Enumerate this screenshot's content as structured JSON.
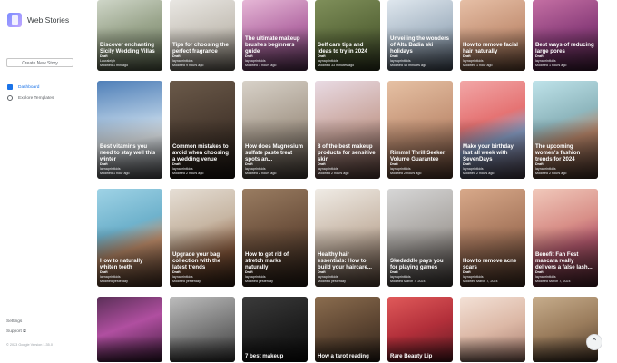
{
  "app": {
    "name": "Web Stories",
    "create_label": "Create New Story"
  },
  "nav": {
    "items": [
      {
        "label": "Dashboard",
        "active": true
      },
      {
        "label": "Explore Templates",
        "active": false
      }
    ],
    "settings_label": "Settings",
    "support_label": "Support ⧉",
    "footer": "© 2023 Google Version 1.35.0"
  },
  "colors": {
    "accent": "#1a73e8",
    "text": "#202124",
    "muted": "#5f6368"
  },
  "stories": [
    {
      "title": "Discover enchanting Sicily Wedding Villas",
      "status": "Draft",
      "author": "Lauraleigh",
      "modified": "Modified 1 min ago",
      "bg": "linear-gradient(160deg,#cfd6c8,#9aa58c 45%,#6c7a5e)"
    },
    {
      "title": "Tips for choosing the perfect fragrance",
      "status": "Draft",
      "author": "laynaprintkids",
      "modified": "Modified 9 hours ago",
      "bg": "linear-gradient(160deg,#e9e7e3,#c8c3ba 50%,#8c8478)"
    },
    {
      "title": "The ultimate makeup brushes beginners guide",
      "status": "Draft",
      "author": "laynaprintkids",
      "modified": "Modified 1 hours ago",
      "bg": "linear-gradient(160deg,#e6b7d6,#b56ea6 50%,#6d3f6a)"
    },
    {
      "title": "Self care tips and ideas to try in 2024",
      "status": "Draft",
      "author": "laynaprintkids",
      "modified": "Modified 33 minutes ago",
      "bg": "linear-gradient(160deg,#7f8f5a,#5c6b3c 50%,#3b4428)"
    },
    {
      "title": "Unveiling the wonders of Alta Badia ski holidays",
      "status": "Draft",
      "author": "laynaprintkids",
      "modified": "Modified 45 minutes ago",
      "bg": "linear-gradient(160deg,#dfe7ee,#a9b8c6 50%,#5a6778)"
    },
    {
      "title": "How to remove facial hair naturally",
      "status": "Draft",
      "author": "laynaprintkids",
      "modified": "Modified 1 hour ago",
      "bg": "linear-gradient(160deg,#e6bfa6,#c79579 50%,#80583f)"
    },
    {
      "title": "Best ways of reducing large pores",
      "status": "Draft",
      "author": "laynaprintkids",
      "modified": "Modified 1 hours ago",
      "bg": "linear-gradient(160deg,#c46fa3,#8c3f7c 50%,#4d2244)"
    },
    {
      "title": "Best vitamins you need to stay well this winter",
      "status": "Draft",
      "author": "laynaprintkids",
      "modified": "Modified 1 hour ago",
      "bg": "linear-gradient(170deg,#4f7fb8,#a9c4df 40%,#e8eef2 60%,#6b6e73)"
    },
    {
      "title": "Common mistakes to avoid when choosing a wedding venue",
      "status": "Draft",
      "author": "laynaprintkids",
      "modified": "Modified 2 hours ago",
      "bg": "linear-gradient(160deg,#6b5a4a,#4a3b30 50%,#221a15)"
    },
    {
      "title": "How does Magnesium sulfate paste treat spots an...",
      "status": "Draft",
      "author": "laynaprintkids",
      "modified": "Modified 2 hours ago",
      "bg": "linear-gradient(160deg,#d8d2c9,#a99d8f 50%,#5d534a)"
    },
    {
      "title": "8 of the best makeup products for sensitive skin",
      "status": "Draft",
      "author": "laynaprintkids",
      "modified": "Modified 2 hours ago",
      "bg": "linear-gradient(160deg,#e9dbe4,#c9a59c 50%,#6e4e46)"
    },
    {
      "title": "Rimmel Thrill Seeker Volume Guarantee",
      "status": "Draft",
      "author": "laynaprintkids",
      "modified": "Modified 2 hours ago",
      "bg": "linear-gradient(160deg,#e6c1a4,#c49376 50%,#6e4c3a)"
    },
    {
      "title": "Make your birthday last all week with SevenDays",
      "status": "Draft",
      "author": "laynaprintkids",
      "modified": "Modified 2 hours ago",
      "bg": "linear-gradient(160deg,#f2a7a7,#e57373 40%,#8aa0c8 60%,#5b4e5e)"
    },
    {
      "title": "The upcoming women's fashion trends for 2024",
      "status": "Draft",
      "author": "laynaprintkids",
      "modified": "Modified 2 hours ago",
      "bg": "linear-gradient(160deg,#bfe3ea,#8fb7be 40%,#b9866a 60%,#5a3f33)"
    },
    {
      "title": "How to naturally whiten teeth",
      "status": "Draft",
      "author": "laynaprintkids",
      "modified": "Modified yesterday",
      "bg": "linear-gradient(160deg,#9fd3e6,#6fb2cc 40%,#c28f6c 60%,#5a3d2c)"
    },
    {
      "title": "Upgrade your bag collection with the latest trends",
      "status": "Draft",
      "author": "laynaprintkids",
      "modified": "Modified yesterday",
      "bg": "linear-gradient(160deg,#e6dfd6,#c7b6a3 40%,#8a5a3c 70%,#3a2518)"
    },
    {
      "title": "How to get rid of stretch marks naturally",
      "status": "Draft",
      "author": "laynaprintkids",
      "modified": "Modified yesterday",
      "bg": "linear-gradient(160deg,#9a7d62,#6b4f3b 50%,#2f2219)"
    },
    {
      "title": "Healthy hair essentials: How to build your haircare...",
      "status": "Draft",
      "author": "laynaprintkids",
      "modified": "Modified yesterday",
      "bg": "linear-gradient(160deg,#f0ece6,#c8b7a7 50%,#6e5646)"
    },
    {
      "title": "Skedaddle pays you for playing games",
      "status": "Draft",
      "author": "laynaprintkids",
      "modified": "Modified March 7, 2024",
      "bg": "linear-gradient(160deg,#d7d7d7,#a9a5a1 50%,#4f4845)"
    },
    {
      "title": "How to remove acne scars",
      "status": "Draft",
      "author": "laynaprintkids",
      "modified": "Modified March 7, 2024",
      "bg": "linear-gradient(160deg,#d8a98a,#a8785d 50%,#513829)"
    },
    {
      "title": "Benefit Fan Fest mascara really delivers a false lash...",
      "status": "Draft",
      "author": "laynaprintkids",
      "modified": "Modified March 7, 2024",
      "bg": "linear-gradient(160deg,#f1c9bb,#d88f88 40%,#b4596e 60%,#5a2a35)"
    },
    {
      "title": "",
      "status": "",
      "author": "",
      "modified": "",
      "bg": "linear-gradient(160deg,#5a2f57,#b04fa0 45%,#3e1b3a)"
    },
    {
      "title": "",
      "status": "",
      "author": "",
      "modified": "",
      "bg": "linear-gradient(160deg,#bdbdbd,#7c7c7c 50%,#3a3a3a)"
    },
    {
      "title": "7 best makeup",
      "status": "",
      "author": "",
      "modified": "",
      "bg": "linear-gradient(160deg,#3b3b3b,#1c1c1c 60%,#0d0d0d)"
    },
    {
      "title": "How a tarot reading",
      "status": "",
      "author": "",
      "modified": "",
      "bg": "linear-gradient(160deg,#8b6d4f,#5f4733 50%,#2f231a)"
    },
    {
      "title": "Rare Beauty Lip",
      "status": "",
      "author": "",
      "modified": "",
      "bg": "linear-gradient(160deg,#e05a5a,#b22f3a 50%,#5e1a22)"
    },
    {
      "title": "",
      "status": "",
      "author": "",
      "modified": "",
      "bg": "linear-gradient(160deg,#f3e1d6,#dcb8a6 50%,#a3786a)"
    },
    {
      "title": "",
      "status": "",
      "author": "",
      "modified": "",
      "bg": "linear-gradient(160deg,#c7ad8c,#9a7c5c 50%,#4d3a2a)"
    }
  ],
  "scroll_top_icon": "arrow-up-icon"
}
